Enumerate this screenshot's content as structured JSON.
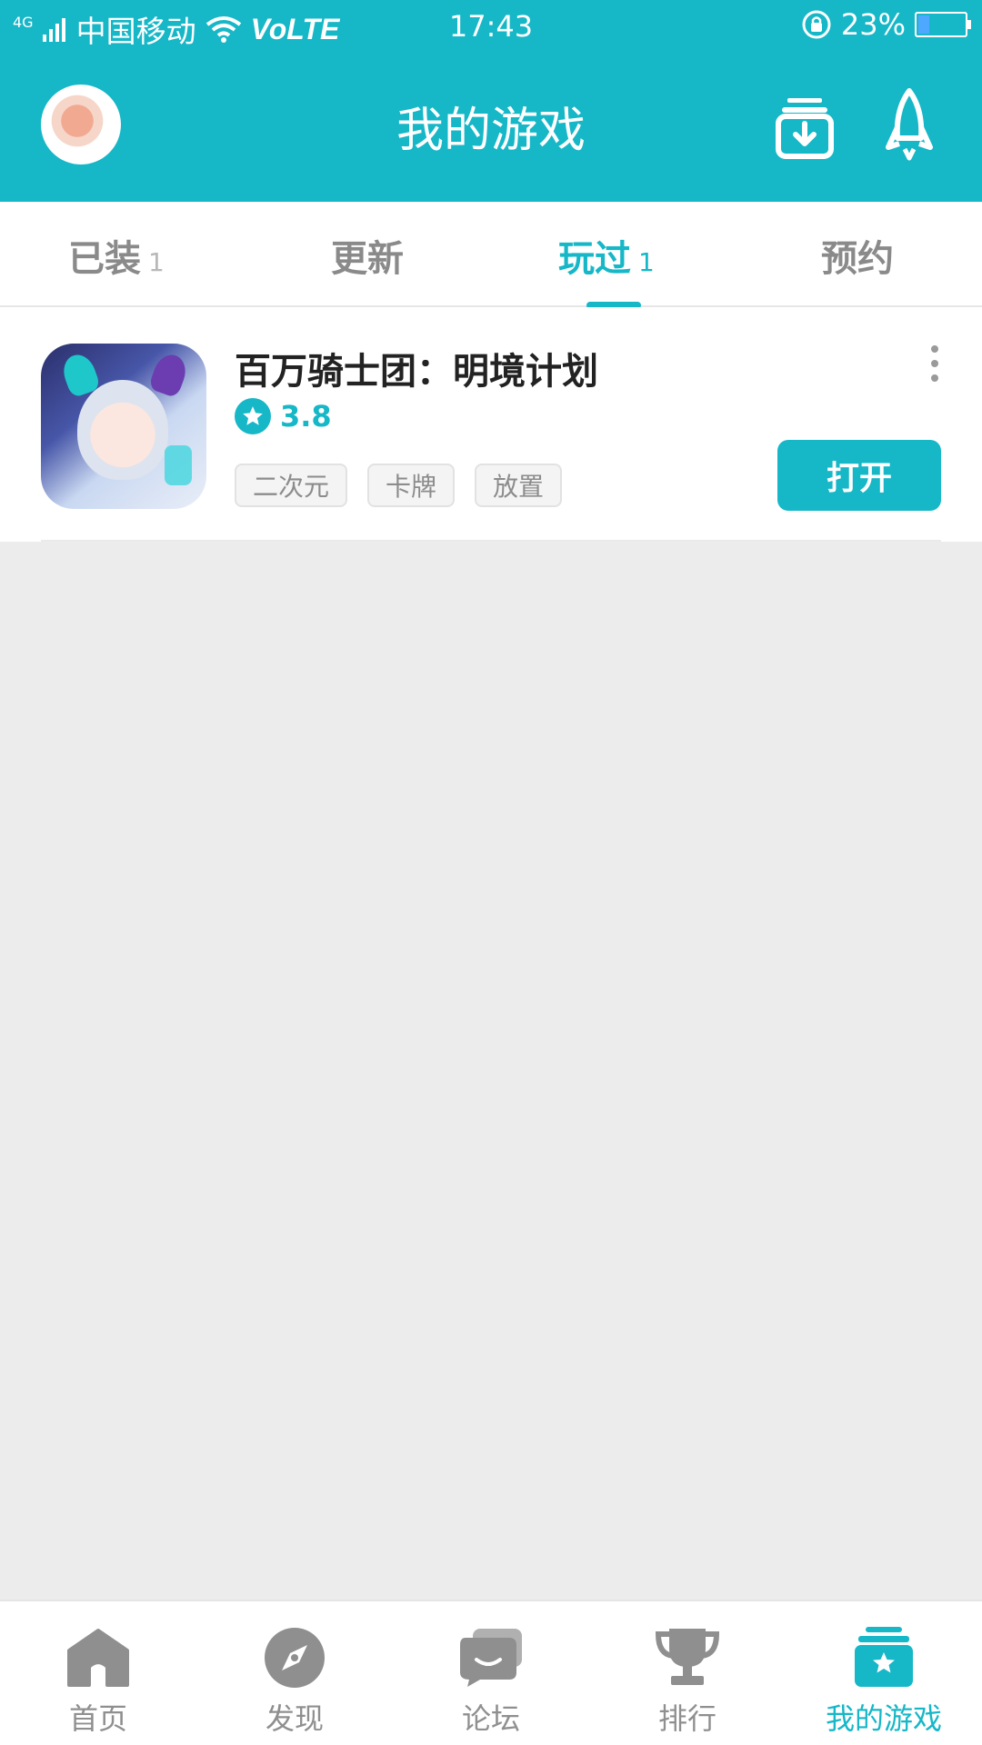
{
  "colors": {
    "accent": "#16b7c7",
    "background": "#ececec",
    "nav_inactive": "#8f8f8f"
  },
  "status_bar": {
    "network": "4G",
    "carrier": "中国移动",
    "volte": "VoLTE",
    "time": "17:43",
    "battery": "23%",
    "battery_level": 0.23
  },
  "header": {
    "title": "我的游戏",
    "icons": [
      "avatar",
      "download-icon",
      "rocket-icon"
    ]
  },
  "tabs": [
    {
      "label": "已装",
      "count": "1",
      "active": false
    },
    {
      "label": "更新",
      "count": "",
      "active": false
    },
    {
      "label": "玩过",
      "count": "1",
      "active": true
    },
    {
      "label": "预约",
      "count": "",
      "active": false
    }
  ],
  "games": [
    {
      "title": "百万骑士团：明境计划",
      "rating": "3.8",
      "tags": [
        "二次元",
        "卡牌",
        "放置"
      ],
      "action": "打开"
    }
  ],
  "bottom_nav": [
    {
      "label": "首页",
      "icon": "home-icon",
      "active": false
    },
    {
      "label": "发现",
      "icon": "compass-icon",
      "active": false
    },
    {
      "label": "论坛",
      "icon": "forum-icon",
      "active": false
    },
    {
      "label": "排行",
      "icon": "trophy-icon",
      "active": false
    },
    {
      "label": "我的游戏",
      "icon": "my-games-icon",
      "active": true
    }
  ]
}
